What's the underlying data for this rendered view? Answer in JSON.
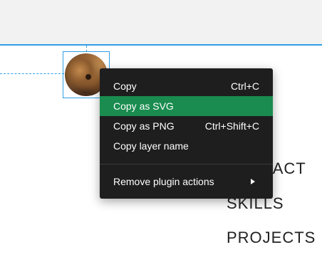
{
  "nav": {
    "contact": "CONTACT",
    "skills": "SKILLS",
    "projects": "PROJECTS"
  },
  "context_menu": {
    "items": [
      {
        "label": "Copy",
        "shortcut": "Ctrl+C",
        "highlighted": false
      },
      {
        "label": "Copy as SVG",
        "shortcut": "",
        "highlighted": true
      },
      {
        "label": "Copy as PNG",
        "shortcut": "Ctrl+Shift+C",
        "highlighted": false
      },
      {
        "label": "Copy layer name",
        "shortcut": "",
        "highlighted": false
      }
    ],
    "submenu_item": {
      "label": "Remove plugin actions",
      "icon": "chevron-right-icon"
    }
  },
  "colors": {
    "selection": "#2f9ee6",
    "menu_bg": "#1e1e1e",
    "highlight": "#1a8c4f"
  }
}
